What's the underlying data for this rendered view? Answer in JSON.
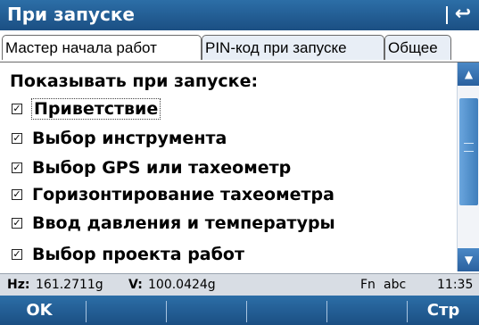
{
  "window": {
    "title": "При запуске",
    "back_icon": "↩"
  },
  "tabs": [
    {
      "label": "Мастер начала работ",
      "active": true
    },
    {
      "label": "PIN-код при запуске",
      "active": false
    },
    {
      "label": "Общее",
      "active": false
    }
  ],
  "content": {
    "heading": "Показывать при запуске:",
    "items": [
      {
        "label": "Приветствие",
        "checked": true,
        "focused": true
      },
      {
        "label": "Выбор инструмента",
        "checked": true
      },
      {
        "label": "Выбор GPS или тахеометр",
        "checked": true
      },
      {
        "label": "Горизонтирование тахеометра",
        "checked": true
      },
      {
        "label": "Ввод давления и температуры",
        "checked": true
      },
      {
        "label": "Выбор проекта работ",
        "checked": true
      }
    ],
    "check_mark": "✓"
  },
  "statusbar": {
    "hz_label": "Hz:",
    "hz_value": "161.2711g",
    "v_label": "V:",
    "v_value": "100.0424g",
    "fn": "Fn",
    "input_mode": "abc",
    "time": "11:35"
  },
  "function_keys": {
    "f1": "OK",
    "f6": "Стр"
  },
  "colors": {
    "title_bg": "#1b4f83",
    "accent": "#3f7dbb"
  }
}
